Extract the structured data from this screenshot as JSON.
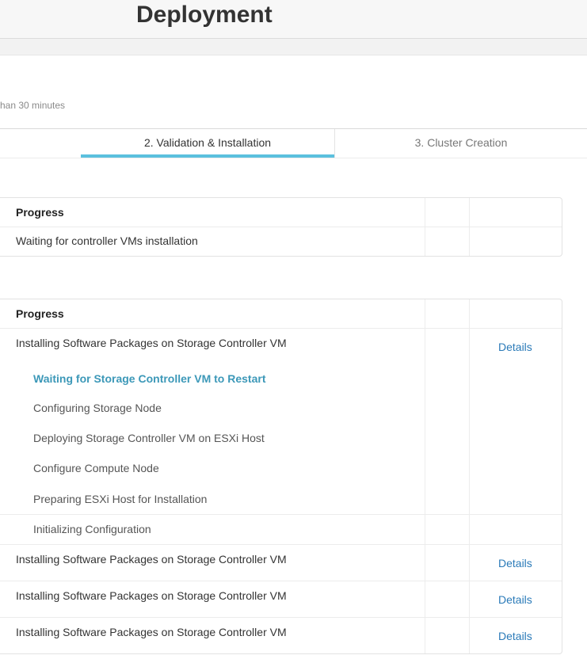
{
  "header": {
    "title": "Deployment"
  },
  "eta_text": "han 30 minutes",
  "tabs": [
    {
      "label": "2. Validation & Installation"
    },
    {
      "label": "3. Cluster Creation"
    }
  ],
  "table1": {
    "header": "Progress",
    "rows": [
      {
        "text": "Waiting for controller VMs installation"
      }
    ]
  },
  "table2": {
    "header": "Progress",
    "rows": [
      {
        "text": "Installing Software Packages on Storage Controller VM",
        "action": "Details"
      },
      {
        "text": "Installing Software Packages on Storage Controller VM",
        "action": "Details"
      },
      {
        "text": "Installing Software Packages on Storage Controller VM",
        "action": "Details"
      },
      {
        "text": "Installing Software Packages on Storage Controller VM",
        "action": "Details"
      }
    ],
    "steps": [
      {
        "text": "Waiting for Storage Controller VM to Restart"
      },
      {
        "text": "Configuring Storage Node"
      },
      {
        "text": "Deploying Storage Controller VM on ESXi Host"
      },
      {
        "text": "Configure Compute Node"
      },
      {
        "text": "Preparing ESXi Host for Installation"
      },
      {
        "text": "Initializing Configuration"
      }
    ]
  },
  "colors": {
    "accent": "#5bc0de",
    "link": "#2a7ab8",
    "active_step": "#3c98b8"
  }
}
